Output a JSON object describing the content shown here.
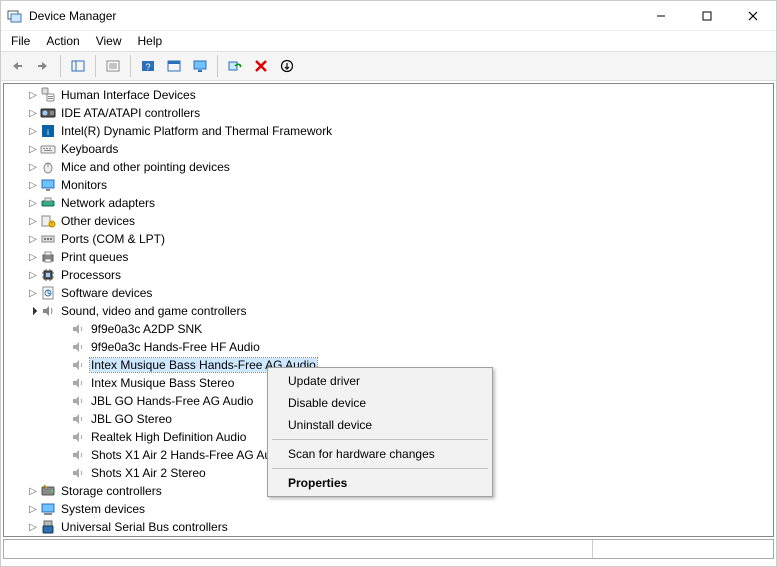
{
  "window": {
    "title": "Device Manager"
  },
  "menu": {
    "file": "File",
    "action": "Action",
    "view": "View",
    "help": "Help"
  },
  "tree": {
    "categories": [
      {
        "label": "Human Interface Devices",
        "icon": "hid"
      },
      {
        "label": "IDE ATA/ATAPI controllers",
        "icon": "ide"
      },
      {
        "label": "Intel(R) Dynamic Platform and Thermal Framework",
        "icon": "intel"
      },
      {
        "label": "Keyboards",
        "icon": "keyboard"
      },
      {
        "label": "Mice and other pointing devices",
        "icon": "mouse"
      },
      {
        "label": "Monitors",
        "icon": "monitor"
      },
      {
        "label": "Network adapters",
        "icon": "network"
      },
      {
        "label": "Other devices",
        "icon": "other"
      },
      {
        "label": "Ports (COM & LPT)",
        "icon": "port"
      },
      {
        "label": "Print queues",
        "icon": "printer"
      },
      {
        "label": "Processors",
        "icon": "cpu"
      },
      {
        "label": "Software devices",
        "icon": "software"
      }
    ],
    "expanded": {
      "label": "Sound, video and game controllers",
      "icon": "sound",
      "children": [
        {
          "label": "9f9e0a3c A2DP SNK"
        },
        {
          "label": "9f9e0a3c Hands-Free HF Audio"
        },
        {
          "label": "Intex Musique Bass Hands-Free AG Audio",
          "selected": true
        },
        {
          "label": "Intex Musique Bass Stereo"
        },
        {
          "label": "JBL GO Hands-Free AG Audio"
        },
        {
          "label": "JBL GO Stereo"
        },
        {
          "label": "Realtek High Definition Audio"
        },
        {
          "label": "Shots X1 Air 2 Hands-Free AG Audio"
        },
        {
          "label": "Shots X1 Air 2 Stereo"
        }
      ]
    },
    "after": [
      {
        "label": "Storage controllers",
        "icon": "storage"
      },
      {
        "label": "System devices",
        "icon": "system"
      },
      {
        "label": "Universal Serial Bus controllers",
        "icon": "usb"
      }
    ]
  },
  "context_menu": {
    "update": "Update driver",
    "disable": "Disable device",
    "uninstall": "Uninstall device",
    "scan": "Scan for hardware changes",
    "properties": "Properties"
  }
}
